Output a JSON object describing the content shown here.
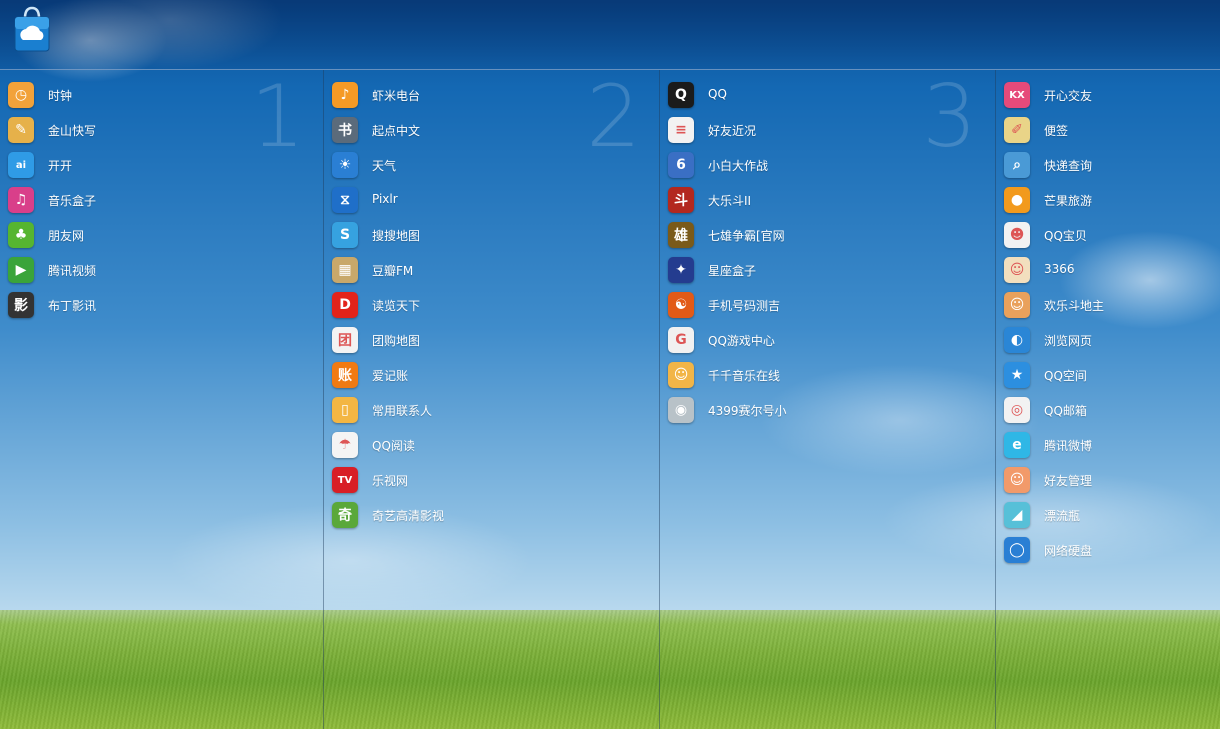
{
  "columns": [
    {
      "number": "1",
      "items": [
        {
          "label": "时钟",
          "icon": "clock-icon",
          "color": "#f2a23a",
          "glyph": "◷"
        },
        {
          "label": "金山快写",
          "icon": "pen-icon",
          "color": "#e6b14a",
          "glyph": "✎"
        },
        {
          "label": "开开",
          "icon": "kaikai-icon",
          "color": "#2f9be6",
          "glyph": "ai"
        },
        {
          "label": "音乐盒子",
          "icon": "music-icon",
          "color": "#d93f8a",
          "glyph": "♫"
        },
        {
          "label": "朋友网",
          "icon": "clover-icon",
          "color": "#56b530",
          "glyph": "♣"
        },
        {
          "label": "腾讯视频",
          "icon": "video-play-icon",
          "color": "#3aa43a",
          "glyph": "▶"
        },
        {
          "label": "布丁影讯",
          "icon": "clapperboard-icon",
          "color": "#333333",
          "glyph": "影"
        }
      ]
    },
    {
      "number": "2",
      "items": [
        {
          "label": "虾米电台",
          "icon": "radio-icon",
          "color": "#f59a25",
          "glyph": "♪"
        },
        {
          "label": "起点中文",
          "icon": "book-icon",
          "color": "#5b6b7b",
          "glyph": "书"
        },
        {
          "label": "天气",
          "icon": "weather-icon",
          "color": "#2a7fd4",
          "glyph": "☀"
        },
        {
          "label": "Pixlr",
          "icon": "pixlr-icon",
          "color": "#1f6fc9",
          "glyph": "⧖"
        },
        {
          "label": "搜搜地图",
          "icon": "map-icon",
          "color": "#36a2e0",
          "glyph": "S"
        },
        {
          "label": "豆瓣FM",
          "icon": "radio-box-icon",
          "color": "#c8a86a",
          "glyph": "▦"
        },
        {
          "label": "读览天下",
          "icon": "reader-icon",
          "color": "#e2231a",
          "glyph": "D"
        },
        {
          "label": "团购地图",
          "icon": "group-buy-icon",
          "color": "#f3f3f3",
          "glyph": "团"
        },
        {
          "label": "爱记账",
          "icon": "accounting-icon",
          "color": "#f07a12",
          "glyph": "账"
        },
        {
          "label": "常用联系人",
          "icon": "contacts-icon",
          "color": "#f3b643",
          "glyph": "▯"
        },
        {
          "label": "QQ阅读",
          "icon": "rss-icon",
          "color": "#f4f4f4",
          "glyph": "☂"
        },
        {
          "label": "乐视网",
          "icon": "letv-icon",
          "color": "#d81e26",
          "glyph": "TV"
        },
        {
          "label": "奇艺高清影视",
          "icon": "qiyi-icon",
          "color": "#5aa83a",
          "glyph": "奇"
        }
      ]
    },
    {
      "number": "3",
      "items": [
        {
          "label": "QQ",
          "icon": "penguin-icon",
          "color": "#1b1b1b",
          "glyph": "Q"
        },
        {
          "label": "好友近况",
          "icon": "friends-news-icon",
          "color": "#f2f2f2",
          "glyph": "≡"
        },
        {
          "label": "小白大作战",
          "icon": "xiaobai-icon",
          "color": "#3a6fc4",
          "glyph": "6"
        },
        {
          "label": "大乐斗II",
          "icon": "daledou-icon",
          "color": "#b3281f",
          "glyph": "斗"
        },
        {
          "label": "七雄争霸[官网",
          "icon": "qixiong-icon",
          "color": "#7a5a1a",
          "glyph": "雄"
        },
        {
          "label": "星座盒子",
          "icon": "constellation-icon",
          "color": "#243c8f",
          "glyph": "✦"
        },
        {
          "label": "手机号码测吉",
          "icon": "bagua-icon",
          "color": "#e25a17",
          "glyph": "☯"
        },
        {
          "label": "QQ游戏中心",
          "icon": "game-center-icon",
          "color": "#f1f1f1",
          "glyph": "G"
        },
        {
          "label": "千千音乐在线",
          "icon": "headphone-icon",
          "color": "#f2b547",
          "glyph": "☺"
        },
        {
          "label": "4399赛尔号小",
          "icon": "seer-icon",
          "color": "#b8c2c8",
          "glyph": "◉"
        }
      ]
    },
    {
      "number": "",
      "items": [
        {
          "label": "开心交友",
          "icon": "kaixin-icon",
          "color": "#e64a7a",
          "glyph": "KX"
        },
        {
          "label": "便签",
          "icon": "note-icon",
          "color": "#e9d488",
          "glyph": "✐"
        },
        {
          "label": "快递查询",
          "icon": "express-icon",
          "color": "#4a9ad6",
          "glyph": "⌕"
        },
        {
          "label": "芒果旅游",
          "icon": "mango-icon",
          "color": "#f29a1d",
          "glyph": "●"
        },
        {
          "label": "QQ宝贝",
          "icon": "qq-baby-icon",
          "color": "#f2f2f2",
          "glyph": "☻"
        },
        {
          "label": "3366",
          "icon": "3366-icon",
          "color": "#f2dfbe",
          "glyph": "☺"
        },
        {
          "label": "欢乐斗地主",
          "icon": "doudizhu-icon",
          "color": "#e9a15c",
          "glyph": "☺"
        },
        {
          "label": "浏览网页",
          "icon": "browser-icon",
          "color": "#2a86d6",
          "glyph": "◐"
        },
        {
          "label": "QQ空间",
          "icon": "qzone-icon",
          "color": "#2c8fe0",
          "glyph": "★"
        },
        {
          "label": "QQ邮箱",
          "icon": "mail-icon",
          "color": "#f2f2f2",
          "glyph": "◎"
        },
        {
          "label": "腾讯微博",
          "icon": "weibo-icon",
          "color": "#2fb7e6",
          "glyph": "e"
        },
        {
          "label": "好友管理",
          "icon": "friend-manage-icon",
          "color": "#f29a6a",
          "glyph": "☺"
        },
        {
          "label": "漂流瓶",
          "icon": "bottle-icon",
          "color": "#57c0d8",
          "glyph": "◢"
        },
        {
          "label": "网络硬盘",
          "icon": "disk-icon",
          "color": "#2a7fd4",
          "glyph": "◯"
        }
      ]
    }
  ]
}
